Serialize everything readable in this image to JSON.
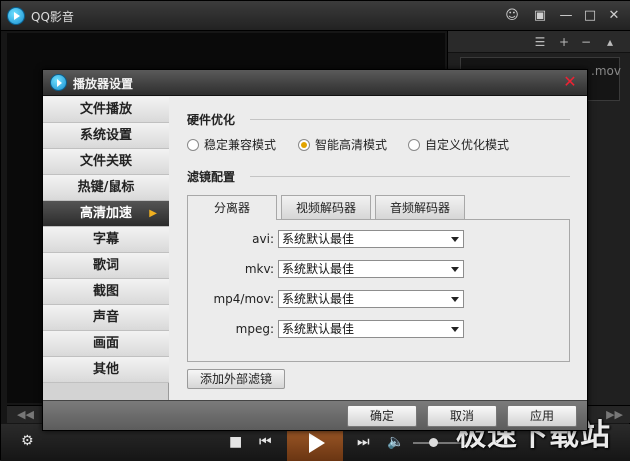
{
  "app": {
    "title": "QQ影音",
    "playlist_file": ".mov",
    "watermark": "极速下载站"
  },
  "dialog": {
    "title": "播放器设置",
    "nav": [
      {
        "label": "文件播放"
      },
      {
        "label": "系统设置"
      },
      {
        "label": "文件关联"
      },
      {
        "label": "热键/鼠标"
      },
      {
        "label": "高清加速",
        "active": true
      },
      {
        "label": "字幕"
      },
      {
        "label": "歌词"
      },
      {
        "label": "截图"
      },
      {
        "label": "声音"
      },
      {
        "label": "画面"
      },
      {
        "label": "其他"
      }
    ],
    "hardware": {
      "title": "硬件优化",
      "options": [
        {
          "label": "稳定兼容模式",
          "selected": false
        },
        {
          "label": "智能高清模式",
          "selected": true
        },
        {
          "label": "自定义优化模式",
          "selected": false
        }
      ]
    },
    "filter": {
      "title": "滤镜配置",
      "tabs": [
        {
          "label": "分离器",
          "active": true
        },
        {
          "label": "视频解码器",
          "active": false
        },
        {
          "label": "音频解码器",
          "active": false
        }
      ],
      "rows": [
        {
          "label": "avi:",
          "value": "系统默认最佳"
        },
        {
          "label": "mkv:",
          "value": "系统默认最佳"
        },
        {
          "label": "mp4/mov:",
          "value": "系统默认最佳"
        },
        {
          "label": "mpeg:",
          "value": "系统默认最佳"
        }
      ],
      "add_button": "添加外部滤镜"
    },
    "footer": {
      "ok": "确定",
      "cancel": "取消",
      "apply": "应用"
    }
  },
  "colors": {
    "accent_play": "#a45d2a",
    "radio_selected": "#e2a400",
    "close_red": "#e23333"
  },
  "icons": {
    "title_bar": [
      "chat-icon",
      "menu-icon",
      "minimize-icon",
      "maximize-icon",
      "close-icon"
    ],
    "playlist": [
      "list-icon",
      "add-icon",
      "remove-icon"
    ],
    "controls": [
      "stop-icon",
      "prev-icon",
      "play-icon",
      "next-icon",
      "volume-icon"
    ]
  }
}
